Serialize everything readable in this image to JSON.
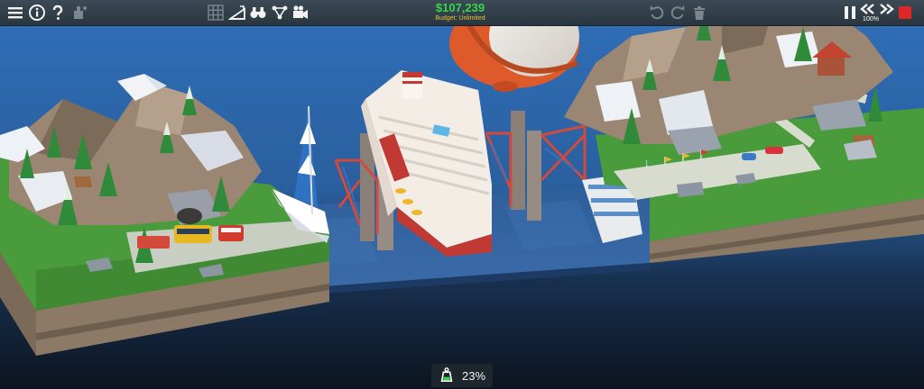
{
  "hud": {
    "money": "$107,239",
    "budget": "Budget: Unlimited",
    "speed_percent": "100%",
    "stress_percent": "23%"
  },
  "colors": {
    "money": "#35d64a",
    "budget": "#e7c33a",
    "record": "#e02525",
    "sky": "#2f6db5",
    "water": "#274f86"
  },
  "icons": [
    "menu-icon",
    "info-icon",
    "help-icon",
    "theme-bucket-icon",
    "grid-icon",
    "ramp-icon",
    "binoculars-icon",
    "graph-icon",
    "camera-icon",
    "undo-icon",
    "redo-icon",
    "trash-icon",
    "pause-icon",
    "rewind-icon",
    "fast-forward-icon",
    "record-icon",
    "weight-icon"
  ]
}
